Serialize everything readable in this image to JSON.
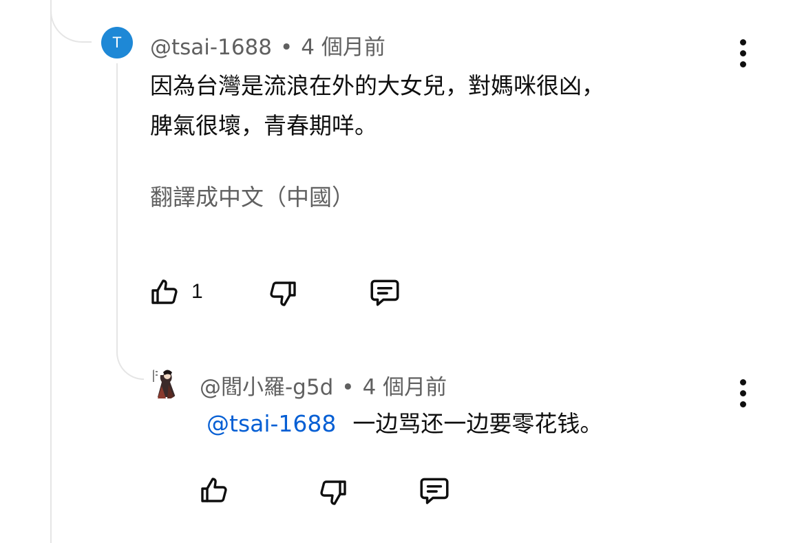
{
  "comment": {
    "avatar_letter": "T",
    "author": "@tsai-1688",
    "separator": "•",
    "time": "4 個月前",
    "text_line1": "因為台灣是流浪在外的大女兒，對媽咪很凶，",
    "text_line2": "脾氣很壞，青春期咩。",
    "translate_label": "翻譯成中文（中國）",
    "like_count": "1",
    "icons": {
      "like": "thumb-up-icon",
      "dislike": "thumb-down-icon",
      "reply": "reply-icon",
      "menu": "more-vertical-icon"
    }
  },
  "reply": {
    "author": "@閻小羅-g5d",
    "separator": "•",
    "time": "4 個月前",
    "mention": "@tsai-1688",
    "text": "一边骂还一边要零花钱。",
    "icons": {
      "like": "thumb-up-icon",
      "dislike": "thumb-down-icon",
      "reply": "reply-icon",
      "menu": "more-vertical-icon"
    }
  },
  "colors": {
    "avatar_bg": "#1e88d6",
    "link": "#065fd4",
    "meta": "#606060",
    "thread_line": "#e5e5e5"
  }
}
